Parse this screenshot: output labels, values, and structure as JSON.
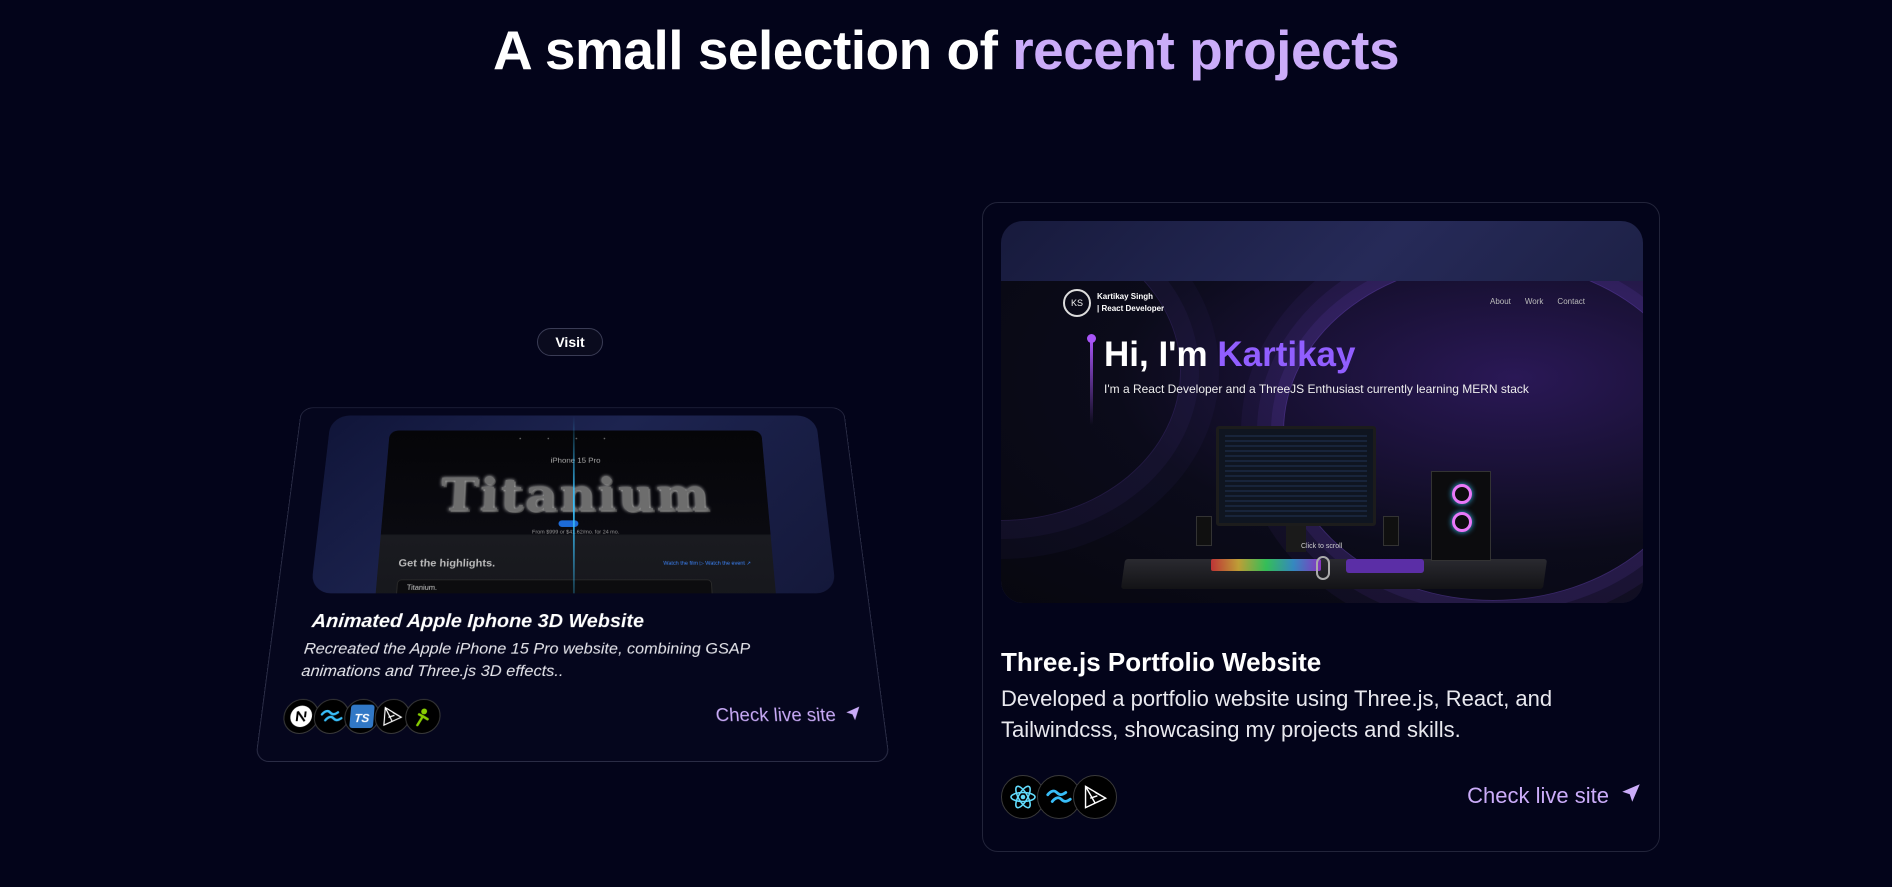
{
  "heading": {
    "prefix": "A small selection of ",
    "accent": "recent projects"
  },
  "colors": {
    "background": "#03041a",
    "accent": "#cbacf9",
    "portfolio_name": "#915eff"
  },
  "projects": [
    {
      "visit_label": "Visit",
      "title": "Animated Apple Iphone 3D Website",
      "description": "Recreated the Apple iPhone 15 Pro website, combining GSAP animations and Three.js 3D effects..",
      "live_label": "Check live site",
      "screenshot": {
        "model": "iPhone 15 Pro",
        "hero": "Titanium",
        "price": "From $999 or $41.62/mo. for 24 mo.",
        "highlights": "Get the highlights.",
        "watch": "Watch the film ▷   Watch the event ↗",
        "box_text": "Titanium."
      },
      "tech_icons": [
        "nextjs-icon",
        "tailwind-icon",
        "typescript-icon",
        "threejs-icon",
        "gsap-icon"
      ]
    },
    {
      "title": "Three.js Portfolio Website",
      "description": "Developed a portfolio website using Three.js, React, and Tailwindcss, showcasing my projects and skills.",
      "live_label": "Check live site",
      "screenshot": {
        "logo": "KS",
        "owner_line1": "Kartikay Singh",
        "owner_line2": "| React Developer",
        "nav": [
          "About",
          "Work",
          "Contact"
        ],
        "greeting": "Hi, I'm ",
        "name": "Kartikay",
        "subtitle": "I'm a React Developer and a ThreeJS Enthusiast currently learning MERN stack",
        "scroll_label": "Click to scroll"
      },
      "tech_icons": [
        "react-icon",
        "tailwind-icon",
        "threejs-icon"
      ]
    }
  ]
}
